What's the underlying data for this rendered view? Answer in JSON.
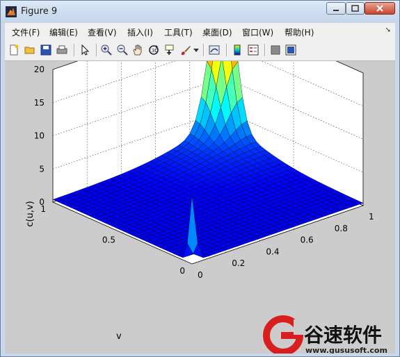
{
  "window": {
    "title": "Figure 9"
  },
  "menu": [
    "文件(F)",
    "编辑(E)",
    "查看(V)",
    "插入(I)",
    "工具(T)",
    "桌面(D)",
    "窗口(W)",
    "帮助(H)"
  ],
  "toolbar_icons": [
    "new-figure-icon",
    "open-file-icon",
    "save-icon",
    "print-icon",
    "arrow-pointer-icon",
    "zoom-in-icon",
    "zoom-out-icon",
    "pan-hand-icon",
    "rotate-3d-icon",
    "data-cursor-icon",
    "brush-icon",
    "link-plot-icon",
    "colorbar-icon",
    "legend-icon",
    "hide-plot-tools-icon",
    "show-plot-tools-icon"
  ],
  "chart_data": {
    "type": "surface",
    "zlabel": "c(u,v)",
    "ylabel": "v",
    "xlabel": "",
    "z_ticks": [
      "0",
      "5",
      "10",
      "15",
      "20"
    ],
    "y_ticks": [
      "0",
      "0.5",
      "1"
    ],
    "x_ticks": [
      "0",
      "0.2",
      "0.4",
      "0.6",
      "0.8",
      "1"
    ],
    "zlim": [
      0,
      20
    ],
    "xlim": [
      0,
      1
    ],
    "ylim": [
      0,
      1
    ],
    "grid": true,
    "colormap": "jet",
    "peaks": [
      {
        "u": 1,
        "v": 1,
        "z": 24
      },
      {
        "u": 0,
        "v": 0,
        "z": 10
      }
    ]
  },
  "watermark": {
    "brand": "谷速软件",
    "url": "www.gususoft.com"
  }
}
